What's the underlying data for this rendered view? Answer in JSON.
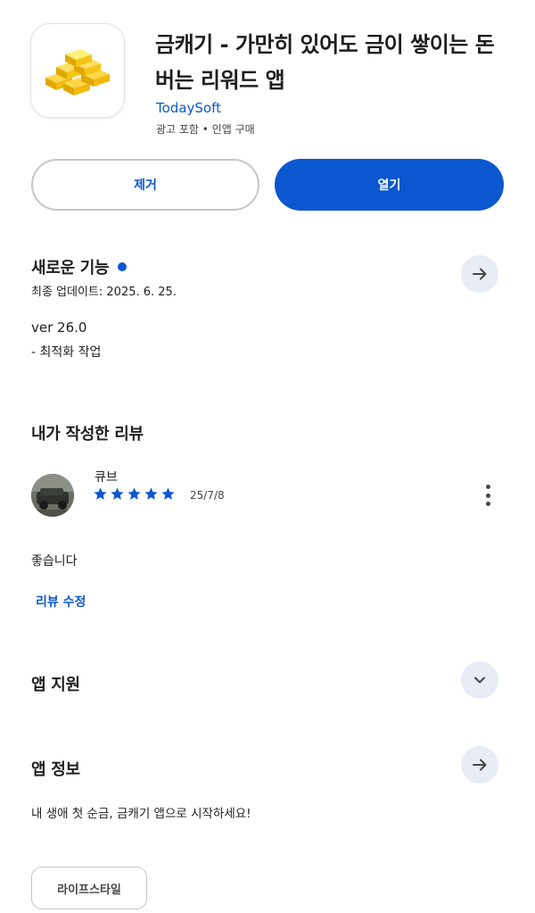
{
  "app": {
    "title": "금캐기 - 가만히 있어도 금이 쌓이는 돈버는 리워드 앱",
    "developer": "TodaySoft",
    "meta": "광고 포함 • 인앱 구매",
    "icon": "gold-bars-icon"
  },
  "actions": {
    "remove_label": "제거",
    "open_label": "열기"
  },
  "whats_new": {
    "title": "새로운 기능",
    "updated": "최종 업데이트: 2025. 6. 25.",
    "version": "ver 26.0",
    "notes": "- 최적화 작업"
  },
  "my_review": {
    "title": "내가 작성한 리뷰",
    "reviewer": "큐브",
    "rating": 5,
    "date": "25/7/8",
    "text": "좋습니다",
    "edit_label": "리뷰 수정"
  },
  "support": {
    "title": "앱 지원"
  },
  "about": {
    "title": "앱 정보",
    "description": "내 생애 첫 순금, 금캐기 앱으로 시작하세요!",
    "category_chip": "라이프스타일"
  },
  "colors": {
    "accent": "#0b57d0",
    "circle_button_bg": "#e8ecf5",
    "star": "#0b57d0"
  }
}
